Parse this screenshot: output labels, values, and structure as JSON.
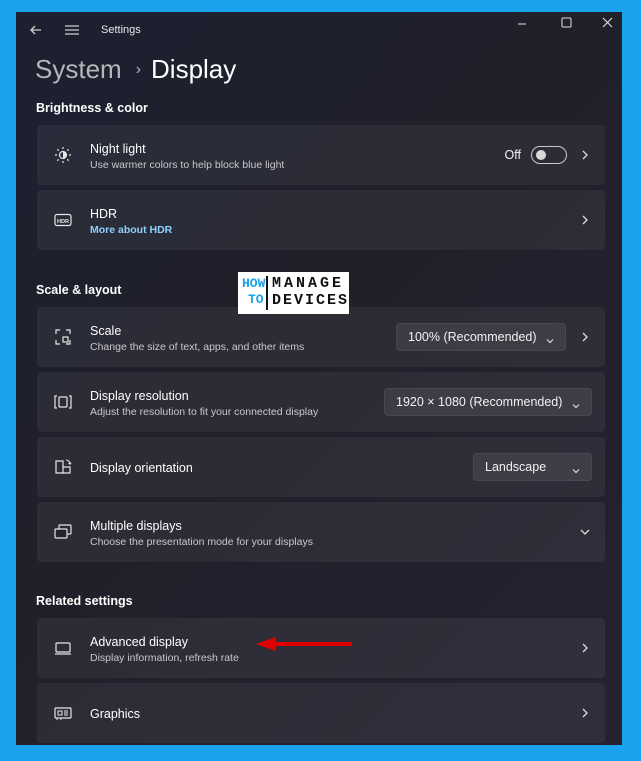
{
  "window": {
    "title": "Settings",
    "controls": [
      "minimize-icon",
      "maximize-icon",
      "close-icon"
    ]
  },
  "breadcrumb": {
    "parent": "System",
    "separator": "›",
    "current": "Display"
  },
  "sections": {
    "brightness": "Brightness & color",
    "scale_layout": "Scale & layout",
    "related": "Related settings"
  },
  "night_light": {
    "title": "Night light",
    "description": "Use warmer colors to help block blue light",
    "toggle_label": "Off",
    "toggle_on": false,
    "icon": "brightness-icon"
  },
  "hdr": {
    "title": "HDR",
    "link": "More about HDR",
    "icon": "hdr-icon"
  },
  "scale": {
    "title": "Scale",
    "description": "Change the size of text, apps, and other items",
    "selected": "100% (Recommended)",
    "icon": "scale-icon"
  },
  "resolution": {
    "title": "Display resolution",
    "description": "Adjust the resolution to fit your connected display",
    "selected": "1920 × 1080 (Recommended)",
    "icon": "resolution-icon"
  },
  "orientation": {
    "title": "Display orientation",
    "selected": "Landscape",
    "icon": "orientation-icon"
  },
  "multiple": {
    "title": "Multiple displays",
    "description": "Choose the presentation mode for your displays",
    "icon": "multiple-displays-icon"
  },
  "advanced": {
    "title": "Advanced display",
    "description": "Display information, refresh rate",
    "icon": "monitor-icon"
  },
  "graphics": {
    "title": "Graphics",
    "icon": "graphics-icon"
  },
  "watermark": {
    "line1a": "HOW",
    "line1b": "MANAGE",
    "line2a": "TO",
    "line2b": "DEVICES"
  },
  "colors": {
    "frame": "#1aa3ec",
    "accent_link": "#8fd1ff",
    "annotation_arrow": "#e00000"
  }
}
